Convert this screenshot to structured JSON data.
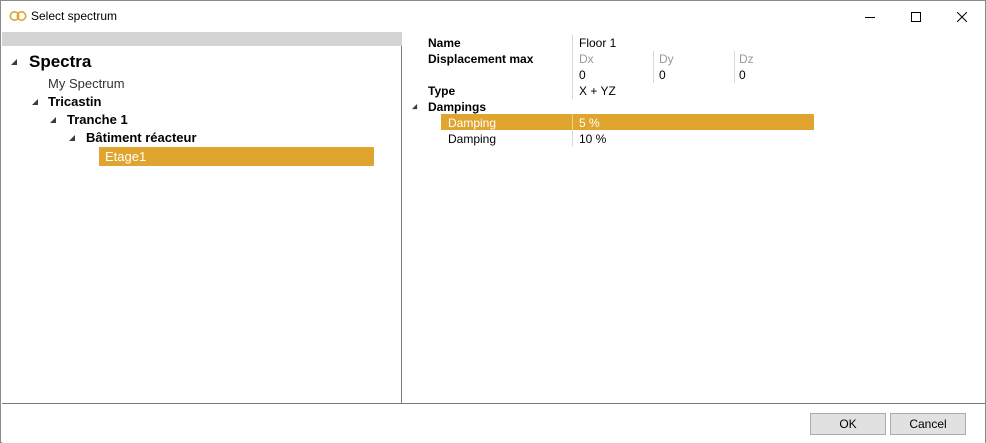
{
  "window": {
    "title": "Select spectrum",
    "icon": "spectrum-app-icon",
    "controls": [
      "minimize-icon",
      "maximize-icon",
      "close-icon"
    ]
  },
  "tree": {
    "root": "Spectra",
    "items": [
      {
        "label": "My Spectrum",
        "level": 1,
        "bold": false,
        "expanded": null
      },
      {
        "label": "Tricastin",
        "level": 1,
        "bold": true,
        "expanded": true
      },
      {
        "label": "Tranche 1",
        "level": 2,
        "bold": true,
        "expanded": true
      },
      {
        "label": "Bâtiment réacteur",
        "level": 3,
        "bold": true,
        "expanded": true
      },
      {
        "label": "Etage1",
        "level": 4,
        "bold": false,
        "selected": true
      }
    ]
  },
  "properties": {
    "name_label": "Name",
    "name_value": "Floor 1",
    "displacement_label": "Displacement max",
    "displacement_headers": [
      "Dx",
      "Dy",
      "Dz"
    ],
    "displacement_values": [
      "0",
      "0",
      "0"
    ],
    "type_label": "Type",
    "type_value": "X + YZ",
    "dampings_label": "Dampings",
    "dampings": [
      {
        "label": "Damping",
        "value": "5 %",
        "selected": true
      },
      {
        "label": "Damping",
        "value": "10 %",
        "selected": false
      }
    ]
  },
  "footer": {
    "ok_label": "OK",
    "cancel_label": "Cancel"
  },
  "colors": {
    "selection": "#e0a52e",
    "header_bar": "#d4d4d4",
    "app_icon": "#e0a52e"
  }
}
